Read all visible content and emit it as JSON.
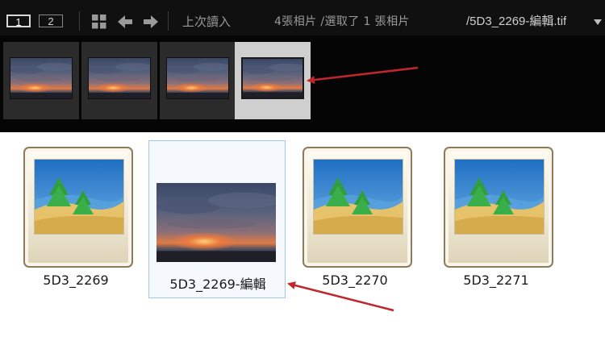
{
  "toolbar": {
    "screen1_label": "1",
    "screen2_label": "2",
    "prev_label": "上次讀入",
    "status_text": "4張相片 /選取了 1 張相片",
    "filename_text": "/5D3_2269-編輯.tif",
    "icons": [
      "grid-icon",
      "arrow-left-icon",
      "arrow-right-icon",
      "dropdown-icon"
    ]
  },
  "filmstrip": {
    "thumbnail_count": 4,
    "selected_index": 3
  },
  "files": [
    {
      "name": "5D3_2269",
      "icon": "image-file-icon",
      "highlighted": false
    },
    {
      "name": "5D3_2269-編輯",
      "icon": "photo-thumbnail",
      "highlighted": true
    },
    {
      "name": "5D3_2270",
      "icon": "image-file-icon",
      "highlighted": false
    },
    {
      "name": "5D3_2271",
      "icon": "image-file-icon",
      "highlighted": false
    }
  ],
  "colors": {
    "toolbar_bg": "#101010",
    "filmstrip_bg": "#050505",
    "selection_outline": "#a8c4e6",
    "annotation_arrow": "#c0272d"
  }
}
